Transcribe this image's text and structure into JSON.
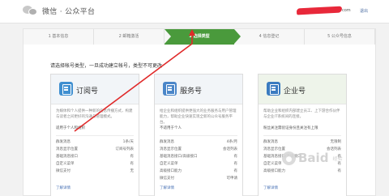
{
  "header": {
    "app_title": "微信 · 公众平台",
    "user_suffix": "com",
    "logout_label": "退出"
  },
  "steps": [
    {
      "label": "1 基本信息",
      "active": false
    },
    {
      "label": "2 邮箱激活",
      "active": false
    },
    {
      "label": "3 选择类型",
      "active": true
    },
    {
      "label": "4 信息登记",
      "active": false
    },
    {
      "label": "5 公众号信息",
      "active": false
    }
  ],
  "main": {
    "heading": "请选择帐号类型，一旦成功建立帐号，类型不可更改"
  },
  "cards": [
    {
      "title": "订阅号",
      "icon_color": "#3f8fd0",
      "desc": "为媒体和个人提供一种新的信息传播方式，构建与读者之间更好的沟通与管理模式。",
      "suit": "适用于个人和组织",
      "features": [
        {
          "k": "群发消息",
          "v": "1条/天"
        },
        {
          "k": "消息显示位置",
          "v": "订阅号列表"
        },
        {
          "k": "基础消息接口",
          "v": "有"
        },
        {
          "k": "自定义菜单",
          "v": "有"
        },
        {
          "k": "微信支付",
          "v": "无"
        }
      ],
      "more": "了解详情"
    },
    {
      "title": "服务号",
      "icon_color": "#4b86c8",
      "desc": "给企业和组织提供更强大的业务服务与用户管理能力，帮助企业快速实现全新的公众号服务平台。",
      "suit": "不适用于个人",
      "features": [
        {
          "k": "群发消息",
          "v": "4条/月"
        },
        {
          "k": "消息显示位置",
          "v": "会话列表"
        },
        {
          "k": "基础消息接口/高级接口",
          "v": "有"
        },
        {
          "k": "自定义菜单",
          "v": "有"
        },
        {
          "k": "高级接口能力",
          "v": "有"
        },
        {
          "k": "微信支付",
          "v": "可申请"
        }
      ],
      "more": "了解详情"
    },
    {
      "title": "企业号",
      "icon_color": "#3a7bc0",
      "desc": "帮助企业和组织内部建立员工、上下游合作伙伴与企业IT系统间的连接。",
      "suit": "粉丝关注需验证身份且关注有上限",
      "features": [
        {
          "k": "群发消息",
          "v": "无限制"
        },
        {
          "k": "消息显示位置",
          "v": "会话列表"
        },
        {
          "k": "基础消息接口/高级接口",
          "v": "有"
        },
        {
          "k": "自定义菜单",
          "v": "有"
        },
        {
          "k": "高级接口能力",
          "v": "有"
        }
      ],
      "more": "了解详情"
    }
  ],
  "watermark": {
    "text": "Baid",
    "sub": "经验"
  }
}
